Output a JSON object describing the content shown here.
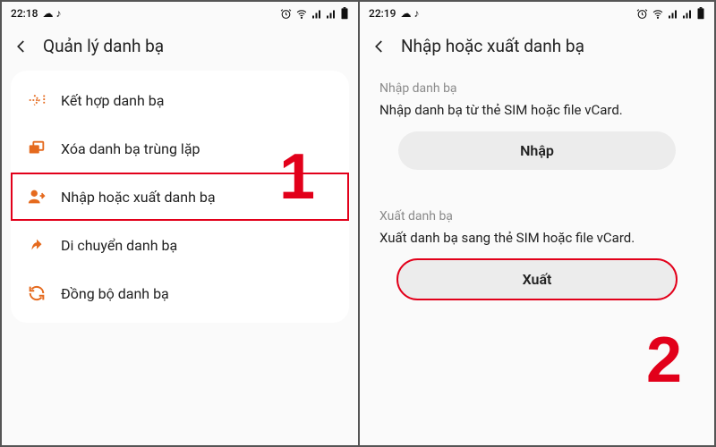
{
  "screen1": {
    "status": {
      "time": "22:18",
      "icons_left": "☁ ♪",
      "icons_right_alt": "alarm wifi signal signal battery"
    },
    "title": "Quản lý danh bạ",
    "items": [
      {
        "label": "Kết hợp danh bạ",
        "icon": "merge-icon"
      },
      {
        "label": "Xóa danh bạ trùng lặp",
        "icon": "dedupe-icon"
      },
      {
        "label": "Nhập hoặc xuất danh bạ",
        "icon": "import-export-icon"
      },
      {
        "label": "Di chuyển danh bạ",
        "icon": "move-icon"
      },
      {
        "label": "Đồng bộ danh bạ",
        "icon": "sync-icon"
      }
    ]
  },
  "screen2": {
    "status": {
      "time": "22:19",
      "icons_left": "☁ ♪",
      "icons_right_alt": "alarm wifi signal signal battery"
    },
    "title": "Nhập hoặc xuất danh bạ",
    "import": {
      "heading": "Nhập danh bạ",
      "desc": "Nhập danh bạ từ thẻ SIM hoặc file vCard.",
      "button": "Nhập"
    },
    "export": {
      "heading": "Xuất danh bạ",
      "desc": "Xuất danh bạ sang thẻ SIM hoặc file vCard.",
      "button": "Xuất"
    }
  },
  "annotations": {
    "one": "1",
    "two": "2"
  },
  "colors": {
    "accent": "#e56a1e",
    "highlight": "#e2001a"
  }
}
